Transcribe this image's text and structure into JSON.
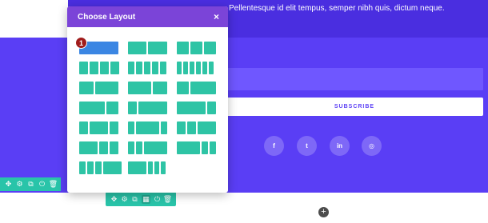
{
  "section": {
    "top_text": "Pellentesque id elit tempus, semper nibh quis, dictum neque.",
    "subscribe_label": "SUBSCRIBE",
    "social_icons": [
      {
        "name": "facebook-icon",
        "glyph": "f"
      },
      {
        "name": "twitter-icon",
        "glyph": "t"
      },
      {
        "name": "linkedin-icon",
        "glyph": "in"
      },
      {
        "name": "instagram-icon",
        "glyph": "◎"
      }
    ]
  },
  "modal": {
    "title": "Choose Layout",
    "close_glyph": "×",
    "step_badge": "1"
  },
  "row_toolbar": {
    "icons": [
      "✥",
      "⚙",
      "⧉",
      "⏻",
      "🗑"
    ]
  },
  "bottom_toolbar": {
    "icons": [
      "✥",
      "⚙",
      "⧉",
      "▦",
      "⏻",
      "🗑"
    ]
  },
  "add_button": "+",
  "colors": {
    "section_bg": "#5a3ef5",
    "modal_header": "#7b44d8",
    "layout_col": "#2ec4a5",
    "layout_selected": "#3b86e3",
    "toolbar": "#29c4a9",
    "badge": "#a01c1c"
  }
}
